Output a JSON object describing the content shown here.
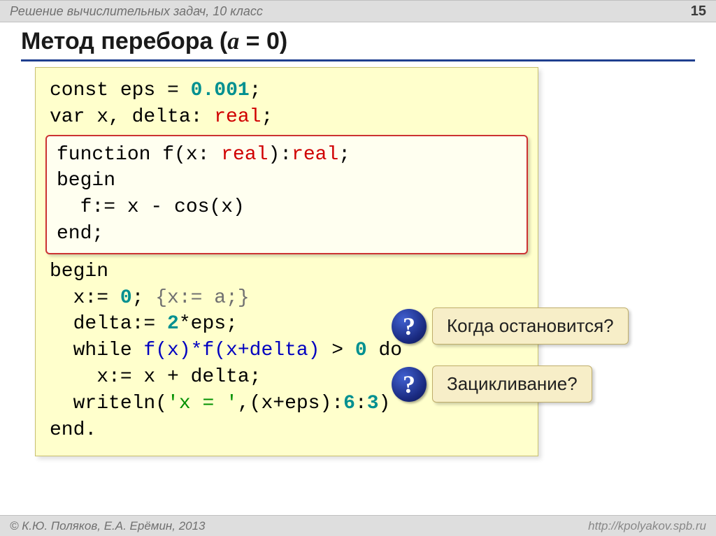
{
  "header": {
    "title": "Решение  вычислительных задач, 10 класс",
    "page_number": "15"
  },
  "slide": {
    "title_prefix": "Метод перебора (",
    "title_param": "a",
    "title_eq": " = 0)",
    "code": {
      "l1a": "const eps",
      "l1b": " = ",
      "l1c": "0.001",
      "l1d": ";",
      "l2a": "var x, delta: ",
      "l2b": "real",
      "l2c": ";",
      "fn1a": "function f(x: ",
      "fn1b": "real",
      "fn1c": "):",
      "fn1d": "real",
      "fn1e": ";",
      "fn2": "begin",
      "fn3": "  f:= x - cos(x)",
      "fn4": "end;",
      "l3": "begin",
      "l4a": "  x:= ",
      "l4b": "0",
      "l4c": "; ",
      "l4d": "{x:= a;}",
      "l5a": "  delta:= ",
      "l5b": "2",
      "l5c": "*eps;",
      "l6a": "  while ",
      "l6b": "f(x)*f(x+delta)",
      "l6c": " > ",
      "l6d": "0",
      "l6e": " do",
      "l7": "    x:= x + delta;",
      "l8a": "  writeln(",
      "l8b": "'x = '",
      "l8c": ",(x+eps):",
      "l8d": "6",
      "l8e": ":",
      "l8f": "3",
      "l8g": ")",
      "l9": "end."
    }
  },
  "callouts": {
    "q_glyph": "?",
    "c1": "Когда остановится?",
    "c2": "Зацикливание?"
  },
  "footer": {
    "left": "© К.Ю. Поляков, Е.А. Ерёмин, 2013",
    "right": "http://kpolyakov.spb.ru"
  }
}
